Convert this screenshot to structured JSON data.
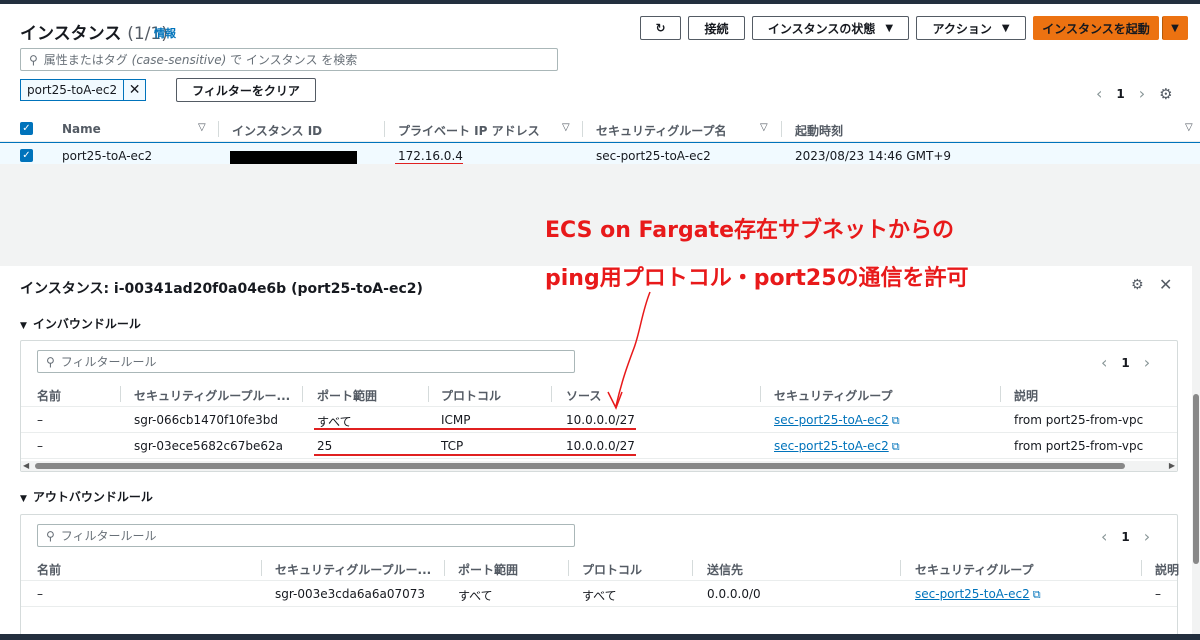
{
  "header": {
    "title": "インスタンス",
    "count": "(1/1)",
    "info_link": "情報",
    "buttons": {
      "connect": "接続",
      "instance_state": "インスタンスの状態",
      "actions": "アクション",
      "launch": "インスタンスを起動"
    },
    "search_placeholder_prefix": "属性またはタグ",
    "search_placeholder_italic": "(case-sensitive)",
    "search_placeholder_suffix": "で インスタンス を検索",
    "filter_chip": "port25-toA-ec2",
    "clear_filters": "フィルターをクリア",
    "page": "1"
  },
  "instances_table": {
    "columns": [
      "Name",
      "インスタンス ID",
      "プライベート IP アドレス",
      "セキュリティグループ名",
      "起動時刻"
    ],
    "rows": [
      {
        "name": "port25-toA-ec2",
        "instance_id": "",
        "private_ip": "172.16.0.4",
        "sg_name": "sec-port25-toA-ec2",
        "launch_time": "2023/08/23 14:46 GMT+9"
      }
    ]
  },
  "annotation": {
    "line1": "ECS on Fargate存在サブネットからの",
    "line2": "ping用プロトコル・port25の通信を許可"
  },
  "details": {
    "title": "インスタンス: i-00341ad20f0a04e6b (port25-toA-ec2)",
    "inbound": {
      "title": "インバウンドルール",
      "filter_placeholder": "フィルタールール",
      "page": "1",
      "columns": [
        "名前",
        "セキュリティグループルー...",
        "ポート範囲",
        "プロトコル",
        "ソース",
        "セキュリティグループ",
        "説明"
      ],
      "rows": [
        {
          "name": "–",
          "rule_id": "sgr-066cb1470f10fe3bd",
          "port": "すべて",
          "protocol": "ICMP",
          "source": "10.0.0.0/27",
          "sg": "sec-port25-toA-ec2",
          "desc": "from port25-from-vpc"
        },
        {
          "name": "–",
          "rule_id": "sgr-03ece5682c67be62a",
          "port": "25",
          "protocol": "TCP",
          "source": "10.0.0.0/27",
          "sg": "sec-port25-toA-ec2",
          "desc": "from port25-from-vpc"
        }
      ]
    },
    "outbound": {
      "title": "アウトバウンドルール",
      "filter_placeholder": "フィルタールール",
      "page": "1",
      "columns": [
        "名前",
        "セキュリティグループルー...",
        "ポート範囲",
        "プロトコル",
        "送信先",
        "セキュリティグループ",
        "説明"
      ],
      "rows": [
        {
          "name": "–",
          "rule_id": "sgr-003e3cda6a6a07073",
          "port": "すべて",
          "protocol": "すべて",
          "dest": "0.0.0.0/0",
          "sg": "sec-port25-toA-ec2",
          "desc": "–"
        }
      ]
    }
  },
  "colors": {
    "primary_button": "#ec7211",
    "link": "#0073bb",
    "annotation": "#e8191a"
  }
}
